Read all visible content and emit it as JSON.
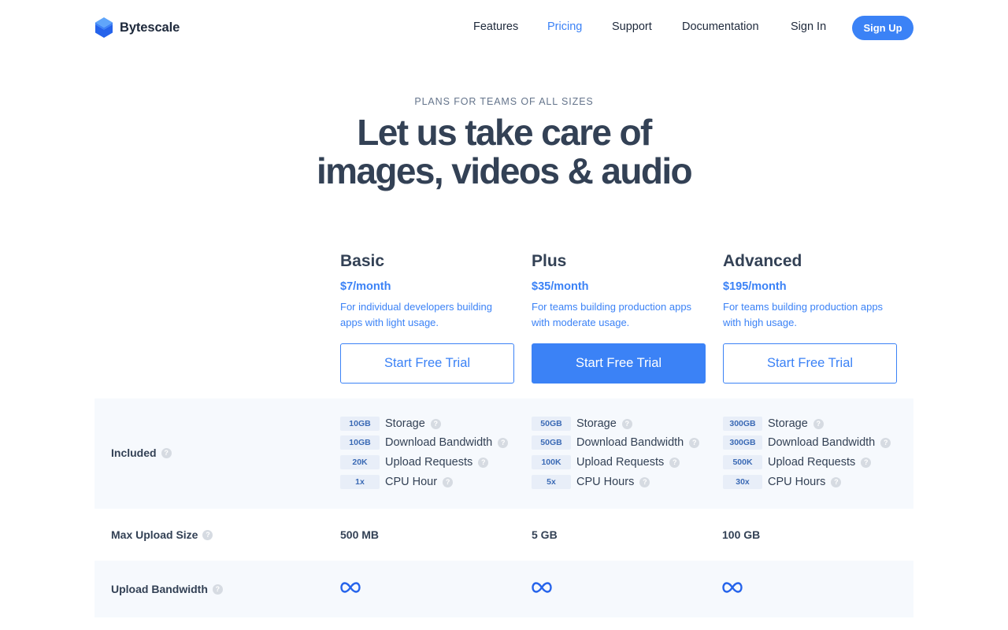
{
  "brand": {
    "name": "Bytescale",
    "logo_icon": "bytescale-hexagon-logo",
    "accent": "#3b82f6"
  },
  "nav": {
    "items": [
      {
        "label": "Features",
        "active": false
      },
      {
        "label": "Pricing",
        "active": true
      },
      {
        "label": "Support",
        "active": false
      },
      {
        "label": "Documentation",
        "active": false
      },
      {
        "label": "Sign In",
        "active": false
      }
    ],
    "signup_label": "Sign Up"
  },
  "hero": {
    "eyebrow": "PLANS FOR TEAMS OF ALL SIZES",
    "headline_line1": "Let us take care of",
    "headline_line2": "images, videos & audio"
  },
  "plans": [
    {
      "name": "Basic",
      "price": "$7/month",
      "description": "For individual developers building apps with light usage.",
      "cta": "Start Free Trial",
      "cta_primary": false,
      "included": [
        {
          "amount": "10GB",
          "label": "Storage"
        },
        {
          "amount": "10GB",
          "label": "Download Bandwidth"
        },
        {
          "amount": "20K",
          "label": "Upload Requests"
        },
        {
          "amount": "1x",
          "label": "CPU Hour"
        }
      ],
      "max_upload_size": "500 MB",
      "upload_bandwidth_icon": "infinity-icon"
    },
    {
      "name": "Plus",
      "price": "$35/month",
      "description": "For teams building production apps with moderate usage.",
      "cta": "Start Free Trial",
      "cta_primary": true,
      "included": [
        {
          "amount": "50GB",
          "label": "Storage"
        },
        {
          "amount": "50GB",
          "label": "Download Bandwidth"
        },
        {
          "amount": "100K",
          "label": "Upload Requests"
        },
        {
          "amount": "5x",
          "label": "CPU Hours"
        }
      ],
      "max_upload_size": "5 GB",
      "upload_bandwidth_icon": "infinity-icon"
    },
    {
      "name": "Advanced",
      "price": "$195/month",
      "description": "For teams building production apps with high usage.",
      "cta": "Start Free Trial",
      "cta_primary": false,
      "included": [
        {
          "amount": "300GB",
          "label": "Storage"
        },
        {
          "amount": "300GB",
          "label": "Download Bandwidth"
        },
        {
          "amount": "500K",
          "label": "Upload Requests"
        },
        {
          "amount": "30x",
          "label": "CPU Hours"
        }
      ],
      "max_upload_size": "100 GB",
      "upload_bandwidth_icon": "infinity-icon"
    }
  ],
  "table": {
    "included_label": "Included",
    "max_upload_label": "Max Upload Size",
    "upload_bandwidth_label": "Upload Bandwidth",
    "help_icon": "question-circle-icon"
  }
}
